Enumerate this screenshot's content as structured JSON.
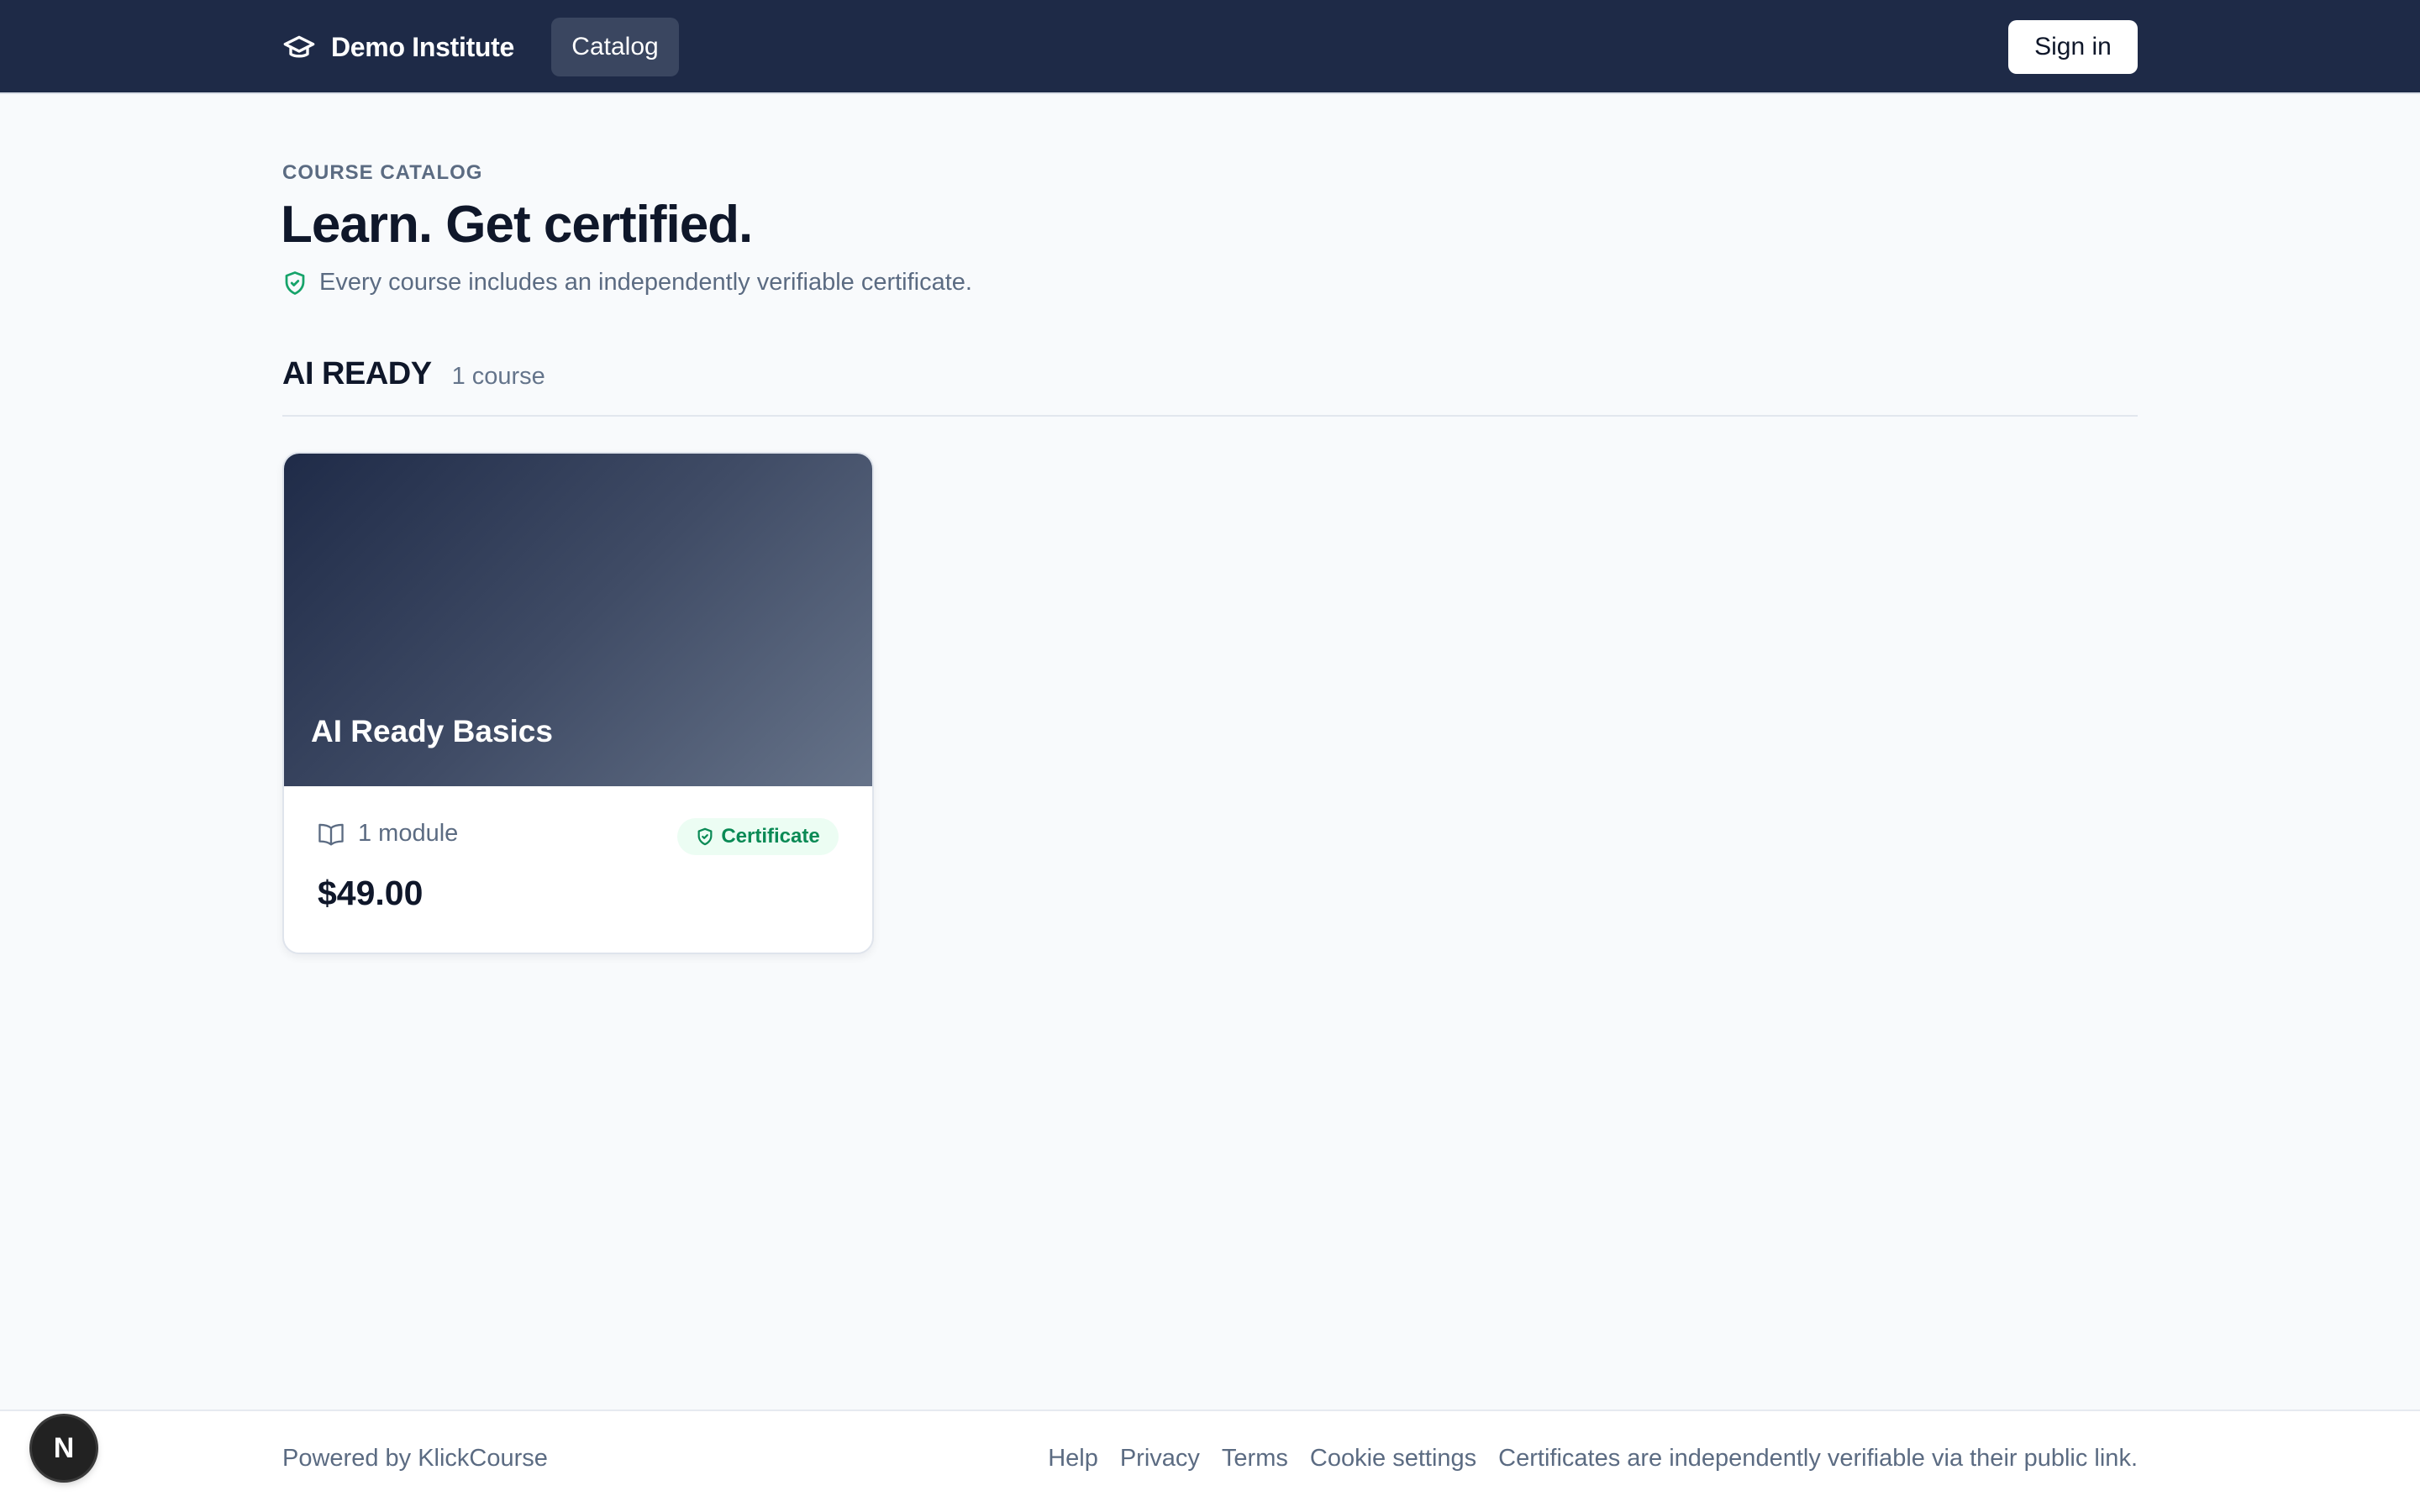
{
  "header": {
    "brand_name": "Demo Institute",
    "brand_icon": "graduation-cap-icon",
    "nav": {
      "catalog_label": "Catalog"
    },
    "signin_label": "Sign in"
  },
  "hero": {
    "eyebrow": "COURSE CATALOG",
    "title": "Learn. Get certified.",
    "subtitle": "Every course includes an independently verifiable certificate.",
    "subtitle_icon": "shield-check-icon"
  },
  "section": {
    "title": "AI READY",
    "count": "1 course"
  },
  "courses": [
    {
      "title": "AI Ready Basics",
      "modules": "1 module",
      "modules_icon": "book-open-icon",
      "badge": "Certificate",
      "badge_icon": "shield-check-icon",
      "price": "$49.00"
    }
  ],
  "footer": {
    "powered_by": "Powered by KlickCourse",
    "links": [
      "Help",
      "Privacy",
      "Terms",
      "Cookie settings",
      "Certificates are independently verifiable via their public link."
    ]
  },
  "dev_badge": {
    "letter": "N",
    "icon": "nextjs-icon"
  },
  "colors": {
    "header_bg": "#1e2a47",
    "page_bg": "#f8fafc",
    "accent_green": "#0a8a55",
    "badge_bg": "#ecfdf3"
  }
}
